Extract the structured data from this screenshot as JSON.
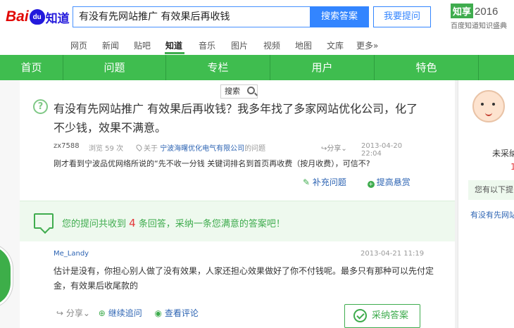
{
  "header": {
    "logo_bai": "Bai",
    "logo_du": "du",
    "logo_zhidao": "知道",
    "search_value": "有没有先网站推广 有效果后再收钱",
    "search_button": "搜索答案",
    "ask_button": "我要提问",
    "zhixiang_logo": "知享",
    "zhixiang_year": "2016",
    "zhixiang_sub": "百度知道知识盛典"
  },
  "nav": {
    "items": [
      "网页",
      "新闻",
      "贴吧",
      "知道",
      "音乐",
      "图片",
      "视频",
      "地图",
      "文库",
      "更多»"
    ],
    "active": "知道"
  },
  "greenbar": {
    "items": [
      "首页",
      "问题",
      "专栏",
      "用户",
      "特色"
    ]
  },
  "mini_search": {
    "label": "搜索",
    "icon": "search-icon"
  },
  "question": {
    "icon": "question-icon",
    "title": "有没有先网站推广 有效果后再收钱？我多年找了多家网站优化公司，化了不少钱，效果不满意。",
    "user": "zx7588",
    "views": "浏览 59 次",
    "about_prefix": "关于",
    "about_company": "宁波海曙优化电气有限公司",
    "about_suffix": "的问题",
    "share": "分享",
    "date": "2013-04-20 22:04",
    "description": "刚才看到宁波品优网络所说的“先不收一分钱 关键词排名到首页再收费（按月收费），可信不?",
    "action_supplement": "补充问题",
    "action_reward": "提高悬赏"
  },
  "answers_bar": {
    "prefix": "您的提问共收到",
    "count": "4",
    "suffix": "条回答，采纳一条您满意的答案吧！"
  },
  "answer": {
    "user": "Me_Landy",
    "date": "2013-04-21 11:19",
    "text": "估计是没有，你担心别人做了没有效果，人家还担心效果做好了你不付钱呢。最多只有那种可以先付定金，有效果后收尾款的",
    "share": "分享",
    "follow_up": "继续追问",
    "view_comments": "查看评论",
    "adopt": "采纳答案"
  },
  "sidebar": {
    "line1": "未采纳",
    "line2": "1",
    "line3": "您有以下提",
    "line4": "有没有先网站"
  }
}
